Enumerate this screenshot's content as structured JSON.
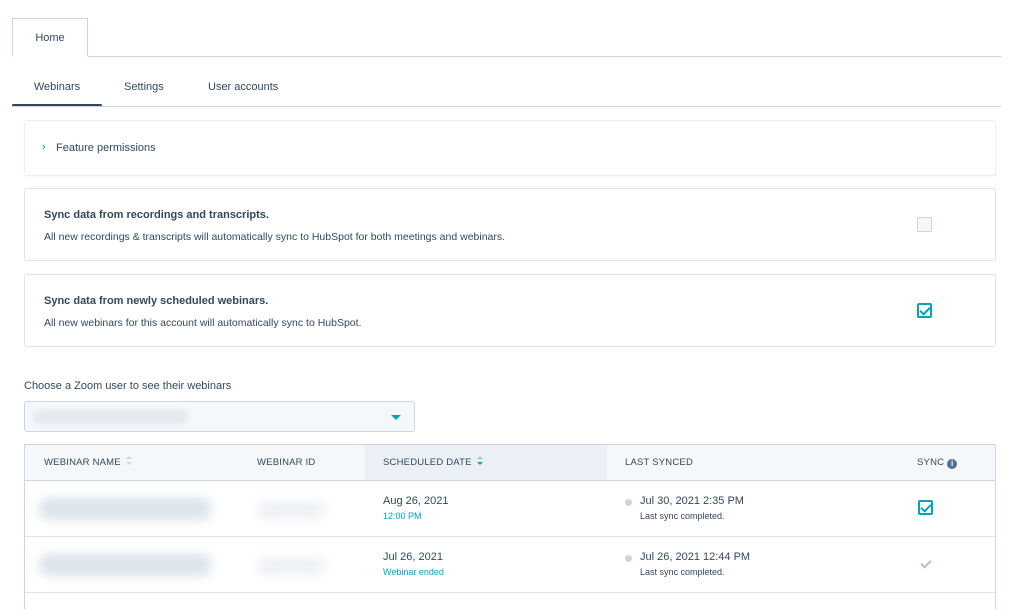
{
  "top_tabs": [
    {
      "label": "Home"
    }
  ],
  "sub_tabs": [
    {
      "label": "Webinars",
      "active": true
    },
    {
      "label": "Settings"
    },
    {
      "label": "User accounts"
    }
  ],
  "feature_permissions": {
    "label": "Feature permissions",
    "icon": "chevron-right-icon"
  },
  "sync_recordings": {
    "title": "Sync data from recordings and transcripts.",
    "description": "All new recordings & transcripts will automatically sync to HubSpot for both meetings and webinars.",
    "checked": false
  },
  "sync_webinars": {
    "title": "Sync data from newly scheduled webinars.",
    "description": "All new webinars for this account will automatically sync to HubSpot.",
    "checked": true
  },
  "zoom_user": {
    "label": "Choose a Zoom user to see their webinars"
  },
  "table": {
    "columns": {
      "name": "WEBINAR NAME",
      "id": "WEBINAR ID",
      "date": "SCHEDULED DATE",
      "synced": "LAST SYNCED",
      "sync": "SYNC"
    },
    "rows": [
      {
        "date": "Aug 26, 2021",
        "date_sub": "12:00 PM",
        "synced": "Jul 30, 2021 2:35 PM",
        "synced_sub": "Last sync completed.",
        "sync": true,
        "sync_disabled": false
      },
      {
        "date": "Jul 26, 2021",
        "date_sub": "Webinar ended",
        "synced": "Jul 26, 2021 12:44 PM",
        "synced_sub": "Last sync completed.",
        "sync": true,
        "sync_disabled": true
      }
    ]
  },
  "colors": {
    "accent": "#00a4bd",
    "text": "#33475b",
    "border": "#cbd6e2",
    "header_bg": "#f5f8fa"
  }
}
